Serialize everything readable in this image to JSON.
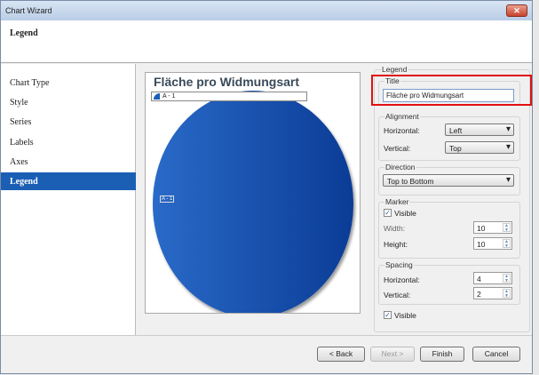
{
  "window": {
    "title": "Chart Wizard",
    "close": "✕"
  },
  "header": {
    "title": "Legend"
  },
  "nav": {
    "items": [
      "Chart Type",
      "Style",
      "Series",
      "Labels",
      "Axes",
      "Legend"
    ],
    "selected": "Legend"
  },
  "preview": {
    "chart_title": "Fläche pro Widmungsart",
    "legend_entry": "A - 1",
    "point_label": "A - 1"
  },
  "legend": {
    "group": "Legend",
    "title_group": "Title",
    "title_value": "Fläche pro Widmungsart",
    "alignment": {
      "label": "Alignment",
      "horizontal_label": "Horizontal:",
      "horizontal": "Left",
      "vertical_label": "Vertical:",
      "vertical": "Top"
    },
    "direction": {
      "label": "Direction",
      "value": "Top to Bottom"
    },
    "marker": {
      "label": "Marker",
      "visible_label": "Visible",
      "visible": true,
      "width_label": "Width:",
      "width": "10",
      "height_label": "Height:",
      "height": "10"
    },
    "spacing": {
      "label": "Spacing",
      "horizontal_label": "Horizontal:",
      "horizontal": "4",
      "vertical_label": "Vertical:",
      "vertical": "2"
    },
    "visible_label": "Visible",
    "visible": true
  },
  "footer": {
    "back": "< Back",
    "next": "Next >",
    "finish": "Finish",
    "cancel": "Cancel"
  },
  "colors": {
    "selection": "#1a5fb4",
    "highlight": "#e01010"
  }
}
